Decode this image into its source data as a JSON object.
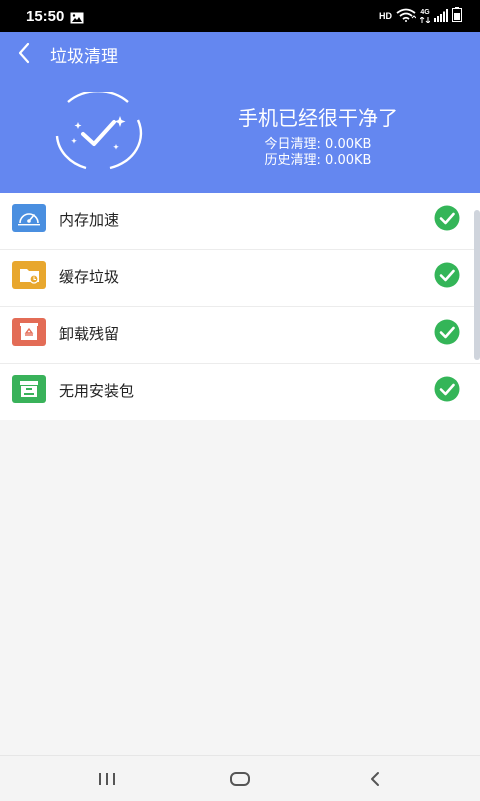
{
  "status_bar": {
    "time": "15:50",
    "hd": "HD",
    "network": "4G",
    "icons": [
      "gallery-icon",
      "wifi-icon",
      "signal-icon",
      "battery-icon"
    ]
  },
  "header": {
    "title": "垃圾清理",
    "headline": "手机已经很干净了",
    "today_clean": "今日清理: 0.00KB",
    "history_clean": "历史清理: 0.00KB",
    "colors": {
      "background": "#6487f0",
      "text": "#ffffff"
    }
  },
  "list": {
    "items": [
      {
        "label": "内存加速",
        "icon": "memory-speed-icon",
        "icon_color": "#4a8fe0",
        "status": "done"
      },
      {
        "label": "缓存垃圾",
        "icon": "cache-folder-icon",
        "icon_color": "#e8a72e",
        "status": "done"
      },
      {
        "label": "卸载残留",
        "icon": "uninstall-residue-icon",
        "icon_color": "#e36c56",
        "status": "done"
      },
      {
        "label": "无用安装包",
        "icon": "apk-package-icon",
        "icon_color": "#39b25a",
        "status": "done"
      }
    ],
    "check_color": "#34b558"
  },
  "nav_bar": {
    "buttons": [
      "recent-apps-icon",
      "home-icon",
      "back-icon"
    ]
  }
}
